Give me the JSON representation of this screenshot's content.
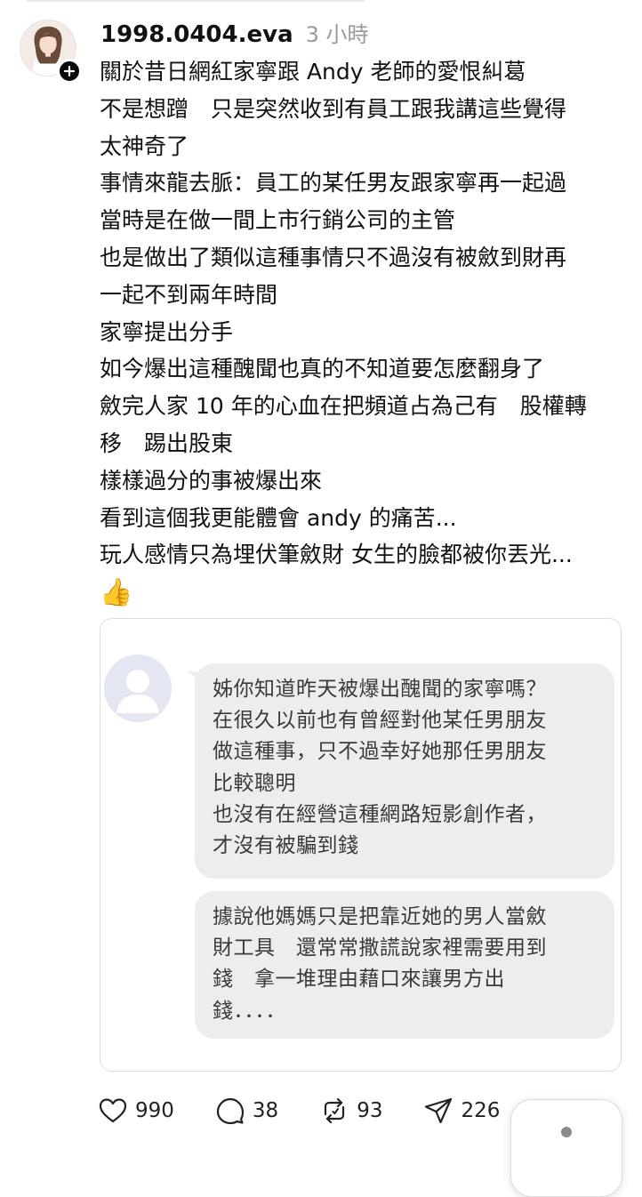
{
  "post": {
    "username": "1998.0404.eva",
    "timestamp": "3 小時",
    "lines": [
      "關於昔日網紅家寧跟 Andy 老師的愛恨糾葛",
      "不是想蹭　只是突然收到有員工跟我講這些覺得",
      "太神奇了",
      "事情來龍去脈：員工的某任男友跟家寧再一起過",
      "當時是在做一間上市行銷公司的主管",
      "也是做出了類似這種事情只不過沒有被斂到財再",
      "一起不到兩年時間",
      "家寧提出分手",
      "如今爆出這種醜聞也真的不知道要怎麼翻身了",
      "斂完人家 10 年的心血在把頻道占為己有　股權轉",
      "移　踢出股東",
      "樣樣過分的事被爆出來",
      "看到這個我更能體會 andy 的痛苦...",
      "玩人感情只為埋伏筆斂財 女生的臉都被你丟光..."
    ],
    "emoji": "👍"
  },
  "attached_image": {
    "bubble_1_lines": [
      "姊你知道昨天被爆出醜聞的家寧嗎？",
      "在很久以前也有曾經對他某任男朋友",
      "做這種事，只不過幸好她那任男朋友",
      "比較聰明",
      "也沒有在經營這種網路短影創作者，",
      "才沒有被騙到錢"
    ],
    "bubble_2_lines": [
      "據說他媽媽只是把靠近她的男人當斂",
      "財工具　還常常撒謊說家裡需要用到",
      "錢　拿一堆理由藉口來讓男方出",
      "錢．．．．"
    ]
  },
  "actions": {
    "like_count": "990",
    "comment_count": "38",
    "repost_count": "93",
    "share_count": "226"
  },
  "icons": {
    "avatar": "profile-photo",
    "follow": "plus-icon",
    "like": "heart-icon",
    "comment": "speech-bubble-icon",
    "repost": "repost-icon",
    "share": "send-icon"
  },
  "colors": {
    "text": "#111111",
    "muted": "#9a9a9a",
    "bubble": "#ededee",
    "border": "#dedede"
  }
}
